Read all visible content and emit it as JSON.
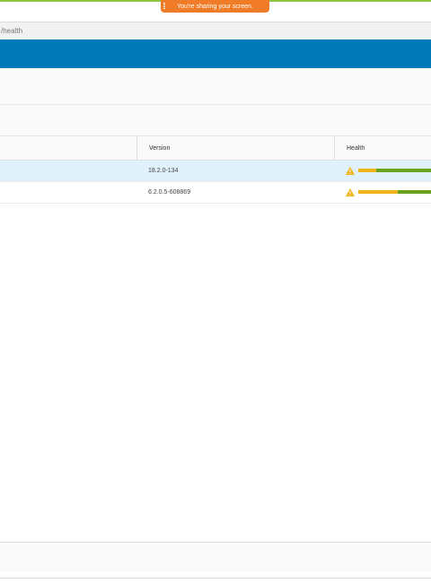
{
  "share_banner": {
    "text": "You're sharing your screen."
  },
  "url_strip": {
    "text": "/health"
  },
  "table": {
    "columns": [
      "Version",
      "Health"
    ],
    "rows": [
      {
        "version": "18.2.0-134",
        "selected": true,
        "health_icon": "warning-icon",
        "health_warn_fraction": 0.25
      },
      {
        "version": "6.2.0.5-608869",
        "selected": false,
        "health_icon": "warning-icon",
        "health_warn_fraction": 0.54
      }
    ]
  },
  "colors": {
    "accent_green": "#8cc63f",
    "share_orange": "#f07c28",
    "header_blue": "#0079b8",
    "health_warn": "#efb41c",
    "health_ok": "#6aa220",
    "selected_row": "#e1f1fb"
  }
}
